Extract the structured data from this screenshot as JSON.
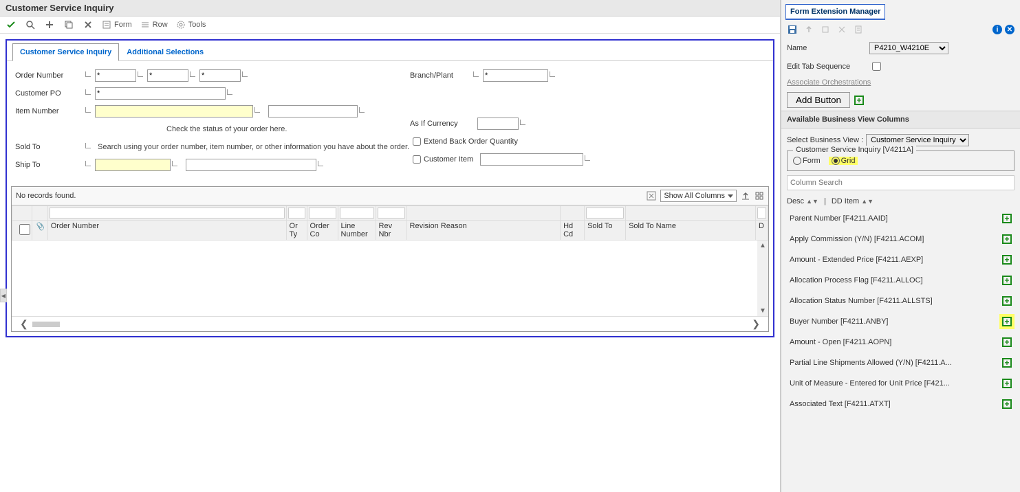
{
  "title": "Customer Service Inquiry",
  "toolbar": {
    "form": "Form",
    "row": "Row",
    "tools": "Tools"
  },
  "tabs": {
    "main": "Customer Service Inquiry",
    "additional": "Additional Selections"
  },
  "form": {
    "orderNumber": {
      "label": "Order Number",
      "v1": "*",
      "v2": "*",
      "v3": "*"
    },
    "customerPO": {
      "label": "Customer PO",
      "value": "*"
    },
    "itemNumber": {
      "label": "Item Number",
      "value": ""
    },
    "soldTo": {
      "label": "Sold To",
      "value": ""
    },
    "shipTo": {
      "label": "Ship To",
      "value": ""
    },
    "branchPlant": {
      "label": "Branch/Plant",
      "value": "*"
    },
    "asIfCurrency": {
      "label": "As If Currency",
      "value": ""
    },
    "extendBackOrder": {
      "label": "Extend Back Order Quantity"
    },
    "customerItem": {
      "label": "Customer Item"
    },
    "hint1": "Check the status of your order here.",
    "hint2": "Search using your order number, item number, or other information you have about the order."
  },
  "grid": {
    "status": "No records found.",
    "showCols": "Show All Columns",
    "headers": {
      "orderNumber": "Order Number",
      "orTy": "Or Ty",
      "orderCo": "Order Co",
      "lineNumber": "Line Number",
      "revNbr": "Rev Nbr",
      "revisionReason": "Revision Reason",
      "hdCd": "Hd Cd",
      "soldTo": "Sold To",
      "soldToName": "Sold To Name",
      "d": "D"
    }
  },
  "fem": {
    "title": "Form Extension Manager",
    "nameLabel": "Name",
    "nameValue": "P4210_W4210E",
    "editTabSeq": "Edit Tab Sequence",
    "assocOrch": "Associate Orchestrations",
    "addButton": "Add Button",
    "availHeader": "Available Business View Columns",
    "selectBV": "Select Business View :",
    "selectBVValue": "Customer Service Inquiry",
    "fieldsetLegend": "Customer Service Inquiry [V4211A]",
    "radioForm": "Form",
    "radioGrid": "Grid",
    "colSearchPlaceholder": "Column Search",
    "descLabel": "Desc",
    "ddItemLabel": "DD Item",
    "columns": [
      {
        "text": "Parent Number [F4211.AAID]",
        "highlight": false
      },
      {
        "text": "Apply Commission (Y/N) [F4211.ACOM]",
        "highlight": false
      },
      {
        "text": "Amount - Extended Price [F4211.AEXP]",
        "highlight": false
      },
      {
        "text": "Allocation Process Flag [F4211.ALLOC]",
        "highlight": false
      },
      {
        "text": "Allocation Status Number [F4211.ALLSTS]",
        "highlight": false
      },
      {
        "text": "Buyer Number [F4211.ANBY]",
        "highlight": true
      },
      {
        "text": "Amount - Open [F4211.AOPN]",
        "highlight": false
      },
      {
        "text": "Partial Line Shipments Allowed (Y/N) [F4211.A...",
        "highlight": false
      },
      {
        "text": "Unit of Measure - Entered for Unit Price [F421...",
        "highlight": false
      },
      {
        "text": "Associated Text [F4211.ATXT]",
        "highlight": false
      }
    ]
  }
}
